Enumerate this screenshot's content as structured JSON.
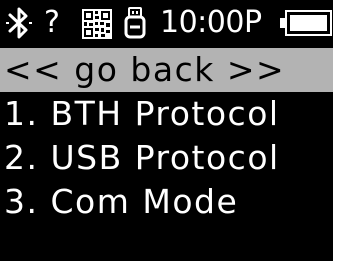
{
  "status_bar": {
    "icons": [
      "bluetooth-icon",
      "help-icon",
      "qr-code-icon",
      "usb-icon",
      "battery-icon"
    ],
    "help_glyph": "?",
    "time": "10:00P",
    "battery_level": 1.0
  },
  "menu": {
    "back_label": "<< go  back >>",
    "items": [
      {
        "label": "1. BTH Protocol"
      },
      {
        "label": "2. USB Protocol"
      },
      {
        "label": "3. Com Mode"
      }
    ]
  },
  "colors": {
    "screen_bg": "#000000",
    "text": "#ffffff",
    "selection_bg": "#b3b3b3",
    "selection_text": "#000000"
  }
}
